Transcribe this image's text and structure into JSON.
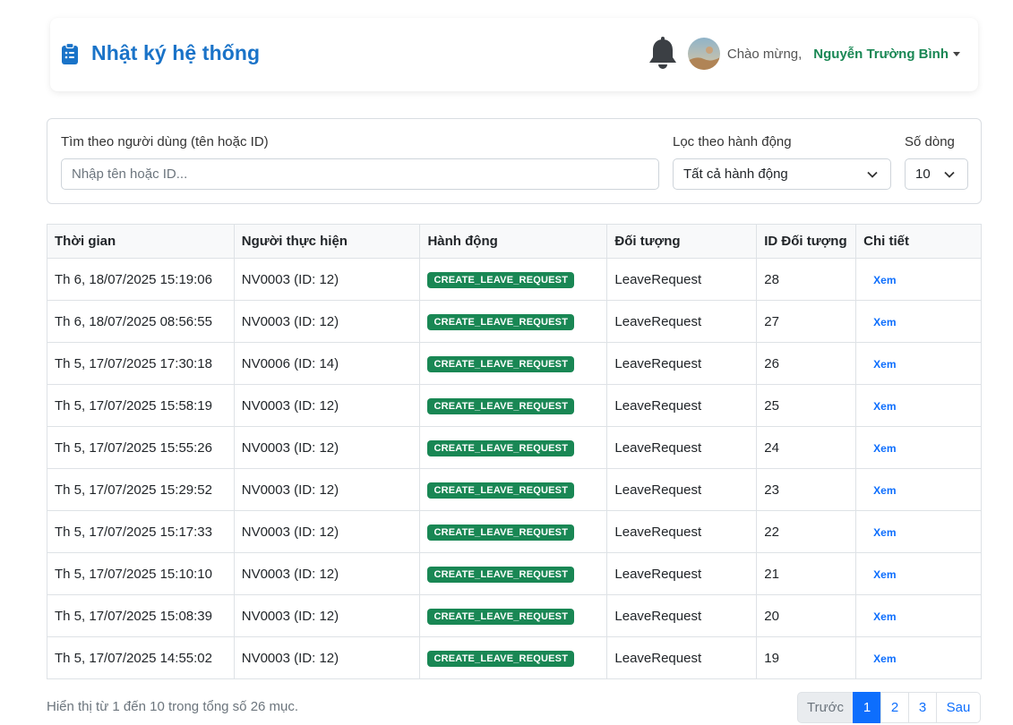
{
  "header": {
    "title": "Nhật ký hệ thống",
    "greeting": "Chào mừng,",
    "user_name": "Nguyễn Trường Bình"
  },
  "filters": {
    "user_label": "Tìm theo người dùng (tên hoặc ID)",
    "user_placeholder": "Nhập tên hoặc ID...",
    "action_label": "Lọc theo hành động",
    "action_value": "Tất cả hành động",
    "rows_label": "Số dòng",
    "rows_value": "10"
  },
  "table": {
    "columns": [
      "Thời gian",
      "Người thực hiện",
      "Hành động",
      "Đối tượng",
      "ID Đối tượng",
      "Chi tiết"
    ],
    "rows": [
      {
        "time": "Th 6, 18/07/2025 15:19:06",
        "user": "NV0003 (ID: 12)",
        "action": "CREATE_LEAVE_REQUEST",
        "object": "LeaveRequest",
        "object_id": "28",
        "detail": "Xem"
      },
      {
        "time": "Th 6, 18/07/2025 08:56:55",
        "user": "NV0003 (ID: 12)",
        "action": "CREATE_LEAVE_REQUEST",
        "object": "LeaveRequest",
        "object_id": "27",
        "detail": "Xem"
      },
      {
        "time": "Th 5, 17/07/2025 17:30:18",
        "user": "NV0006 (ID: 14)",
        "action": "CREATE_LEAVE_REQUEST",
        "object": "LeaveRequest",
        "object_id": "26",
        "detail": "Xem"
      },
      {
        "time": "Th 5, 17/07/2025 15:58:19",
        "user": "NV0003 (ID: 12)",
        "action": "CREATE_LEAVE_REQUEST",
        "object": "LeaveRequest",
        "object_id": "25",
        "detail": "Xem"
      },
      {
        "time": "Th 5, 17/07/2025 15:55:26",
        "user": "NV0003 (ID: 12)",
        "action": "CREATE_LEAVE_REQUEST",
        "object": "LeaveRequest",
        "object_id": "24",
        "detail": "Xem"
      },
      {
        "time": "Th 5, 17/07/2025 15:29:52",
        "user": "NV0003 (ID: 12)",
        "action": "CREATE_LEAVE_REQUEST",
        "object": "LeaveRequest",
        "object_id": "23",
        "detail": "Xem"
      },
      {
        "time": "Th 5, 17/07/2025 15:17:33",
        "user": "NV0003 (ID: 12)",
        "action": "CREATE_LEAVE_REQUEST",
        "object": "LeaveRequest",
        "object_id": "22",
        "detail": "Xem"
      },
      {
        "time": "Th 5, 17/07/2025 15:10:10",
        "user": "NV0003 (ID: 12)",
        "action": "CREATE_LEAVE_REQUEST",
        "object": "LeaveRequest",
        "object_id": "21",
        "detail": "Xem"
      },
      {
        "time": "Th 5, 17/07/2025 15:08:39",
        "user": "NV0003 (ID: 12)",
        "action": "CREATE_LEAVE_REQUEST",
        "object": "LeaveRequest",
        "object_id": "20",
        "detail": "Xem"
      },
      {
        "time": "Th 5, 17/07/2025 14:55:02",
        "user": "NV0003 (ID: 12)",
        "action": "CREATE_LEAVE_REQUEST",
        "object": "LeaveRequest",
        "object_id": "19",
        "detail": "Xem"
      }
    ]
  },
  "footer": {
    "summary": "Hiển thị từ 1 đến 10 trong tổng số 26 mục.",
    "prev_label": "Trước",
    "pages": [
      "1",
      "2",
      "3"
    ],
    "active_page": "1",
    "next_label": "Sau"
  },
  "colors": {
    "title": "#1a73c8",
    "user_name": "#198754",
    "badge": "#198754",
    "link": "#0d6efd",
    "active_page": "#0d6efd"
  }
}
